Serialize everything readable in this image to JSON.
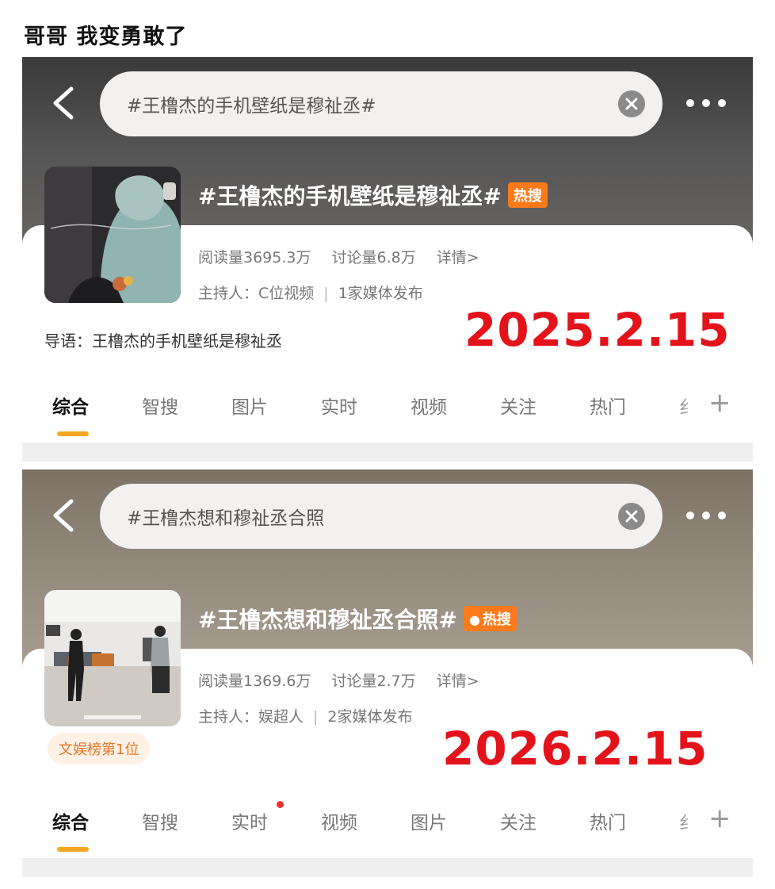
{
  "caption": "哥哥  我变勇敢了",
  "panels": [
    {
      "search_text": "#王橹杰的手机壁纸是穆祉丞#",
      "topic_title": "#王橹杰的手机壁纸是穆祉丞#",
      "hot_badge": "热搜",
      "read_count": "阅读量3695.3万",
      "discuss_count": "讨论量6.8万",
      "detail_link": "详情>",
      "host": "主持人：C位视频",
      "media": "1家媒体发布",
      "guide": "导语：王橹杰的手机壁纸是穆祉丞",
      "date_stamp": "2025.2.15",
      "tabs": [
        "综合",
        "智搜",
        "图片",
        "实时",
        "视频",
        "关注",
        "热门",
        "纟"
      ],
      "active_tab": "综合"
    },
    {
      "search_text": "#王橹杰想和穆祉丞合照",
      "topic_title": "#王橹杰想和穆祉丞合照#",
      "hot_badge": "热搜",
      "read_count": "阅读量1369.6万",
      "discuss_count": "讨论量2.7万",
      "detail_link": "详情>",
      "host": "主持人：娱超人",
      "media": "2家媒体发布",
      "rank_badge": "文娱榜第1位",
      "date_stamp": "2026.2.15",
      "tabs": [
        "综合",
        "智搜",
        "实时",
        "视频",
        "图片",
        "关注",
        "热门",
        "纟"
      ],
      "active_tab": "综合",
      "dot_tab": "实时"
    }
  ],
  "icons": {
    "back": "chevron-left-icon",
    "clear": "close-circle-icon",
    "more": "more-dots-icon",
    "add": "plus-icon",
    "flame": "flame-icon"
  },
  "colors": {
    "accent": "#f5a623",
    "hot_badge": "#ff7a1a",
    "date_stamp": "#e4131b",
    "notif_dot": "#e8342c",
    "rank_badge_text": "#e0782b"
  }
}
